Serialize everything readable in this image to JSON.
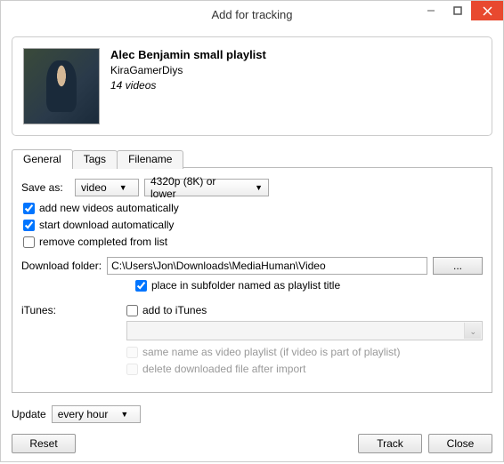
{
  "window": {
    "title": "Add for tracking"
  },
  "playlist": {
    "title": "Alec Benjamin small playlist",
    "author": "KiraGamerDiys",
    "count": "14 videos"
  },
  "tabs": {
    "general": "General",
    "tags": "Tags",
    "filename": "Filename"
  },
  "general": {
    "save_as_label": "Save as:",
    "format_value": "video",
    "quality_value": "4320p (8K) or lower",
    "add_new_auto": "add new videos automatically",
    "start_dl_auto": "start download automatically",
    "remove_completed": "remove completed from list",
    "download_folder_label": "Download folder:",
    "download_folder_value": "C:\\Users\\Jon\\Downloads\\MediaHuman\\Video",
    "browse_label": "...",
    "subfolder_label": "place in subfolder named as playlist title",
    "itunes_label": "iTunes:",
    "add_to_itunes": "add to iTunes",
    "same_name_label": "same name as video playlist (if video is part of playlist)",
    "delete_after_import": "delete downloaded file after import"
  },
  "footer": {
    "update_label": "Update",
    "update_value": "every hour",
    "reset": "Reset",
    "track": "Track",
    "close": "Close"
  }
}
